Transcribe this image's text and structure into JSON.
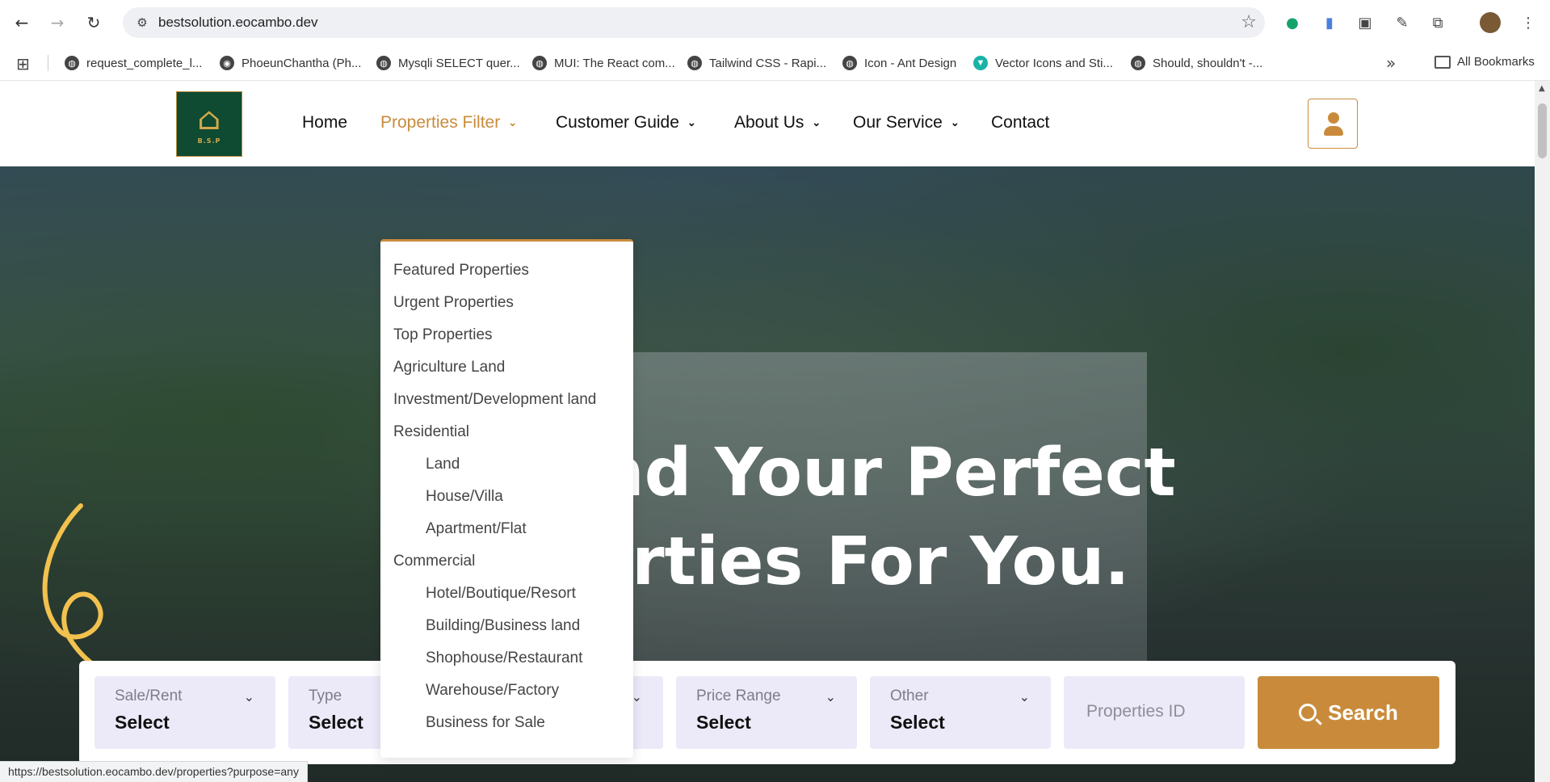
{
  "browser": {
    "url": "bestsolution.eocambo.dev",
    "bookmarks": [
      {
        "label": "request_complete_l..."
      },
      {
        "label": "PhoeunChantha (Ph..."
      },
      {
        "label": "Mysqli SELECT quer..."
      },
      {
        "label": "MUI: The React com..."
      },
      {
        "label": "Tailwind CSS - Rapi..."
      },
      {
        "label": "Icon - Ant Design"
      },
      {
        "label": "Vector Icons and Sti..."
      },
      {
        "label": "Should, shouldn't -..."
      }
    ],
    "all_bookmarks": "All Bookmarks",
    "status_url": "https://bestsolution.eocambo.dev/properties?purpose=any"
  },
  "header": {
    "logo_text": "B.S.P",
    "nav": [
      {
        "label": "Home"
      },
      {
        "label": "Properties Filter"
      },
      {
        "label": "Customer Guide"
      },
      {
        "label": "About Us"
      },
      {
        "label": "Our Service"
      },
      {
        "label": "Contact"
      }
    ]
  },
  "dropdown": {
    "items": [
      {
        "label": "Featured Properties"
      },
      {
        "label": "Urgent Properties"
      },
      {
        "label": "Top Properties"
      },
      {
        "label": "Agriculture Land"
      },
      {
        "label": "Investment/Development land"
      },
      {
        "label": "Residential"
      },
      {
        "label": "Land"
      },
      {
        "label": "House/Villa"
      },
      {
        "label": "Apartment/Flat"
      },
      {
        "label": "Commercial"
      },
      {
        "label": "Hotel/Boutique/Resort"
      },
      {
        "label": "Building/Business land"
      },
      {
        "label": "Shophouse/Restaurant"
      },
      {
        "label": "Warehouse/Factory"
      },
      {
        "label": "Business for Sale"
      }
    ]
  },
  "hero": {
    "title_line1": "nd Your Perfect",
    "title_line2": "erties For You."
  },
  "search": {
    "fields": [
      {
        "label": "Sale/Rent",
        "value": "Select"
      },
      {
        "label": "Type",
        "value": "Select"
      },
      {
        "label": "",
        "value": ""
      },
      {
        "label": "Price Range",
        "value": "Select"
      },
      {
        "label": "Other",
        "value": "Select"
      }
    ],
    "id_placeholder": "Properties ID",
    "button": "Search"
  },
  "colors": {
    "accent": "#c98b3b",
    "field_bg": "#eceaf8"
  }
}
